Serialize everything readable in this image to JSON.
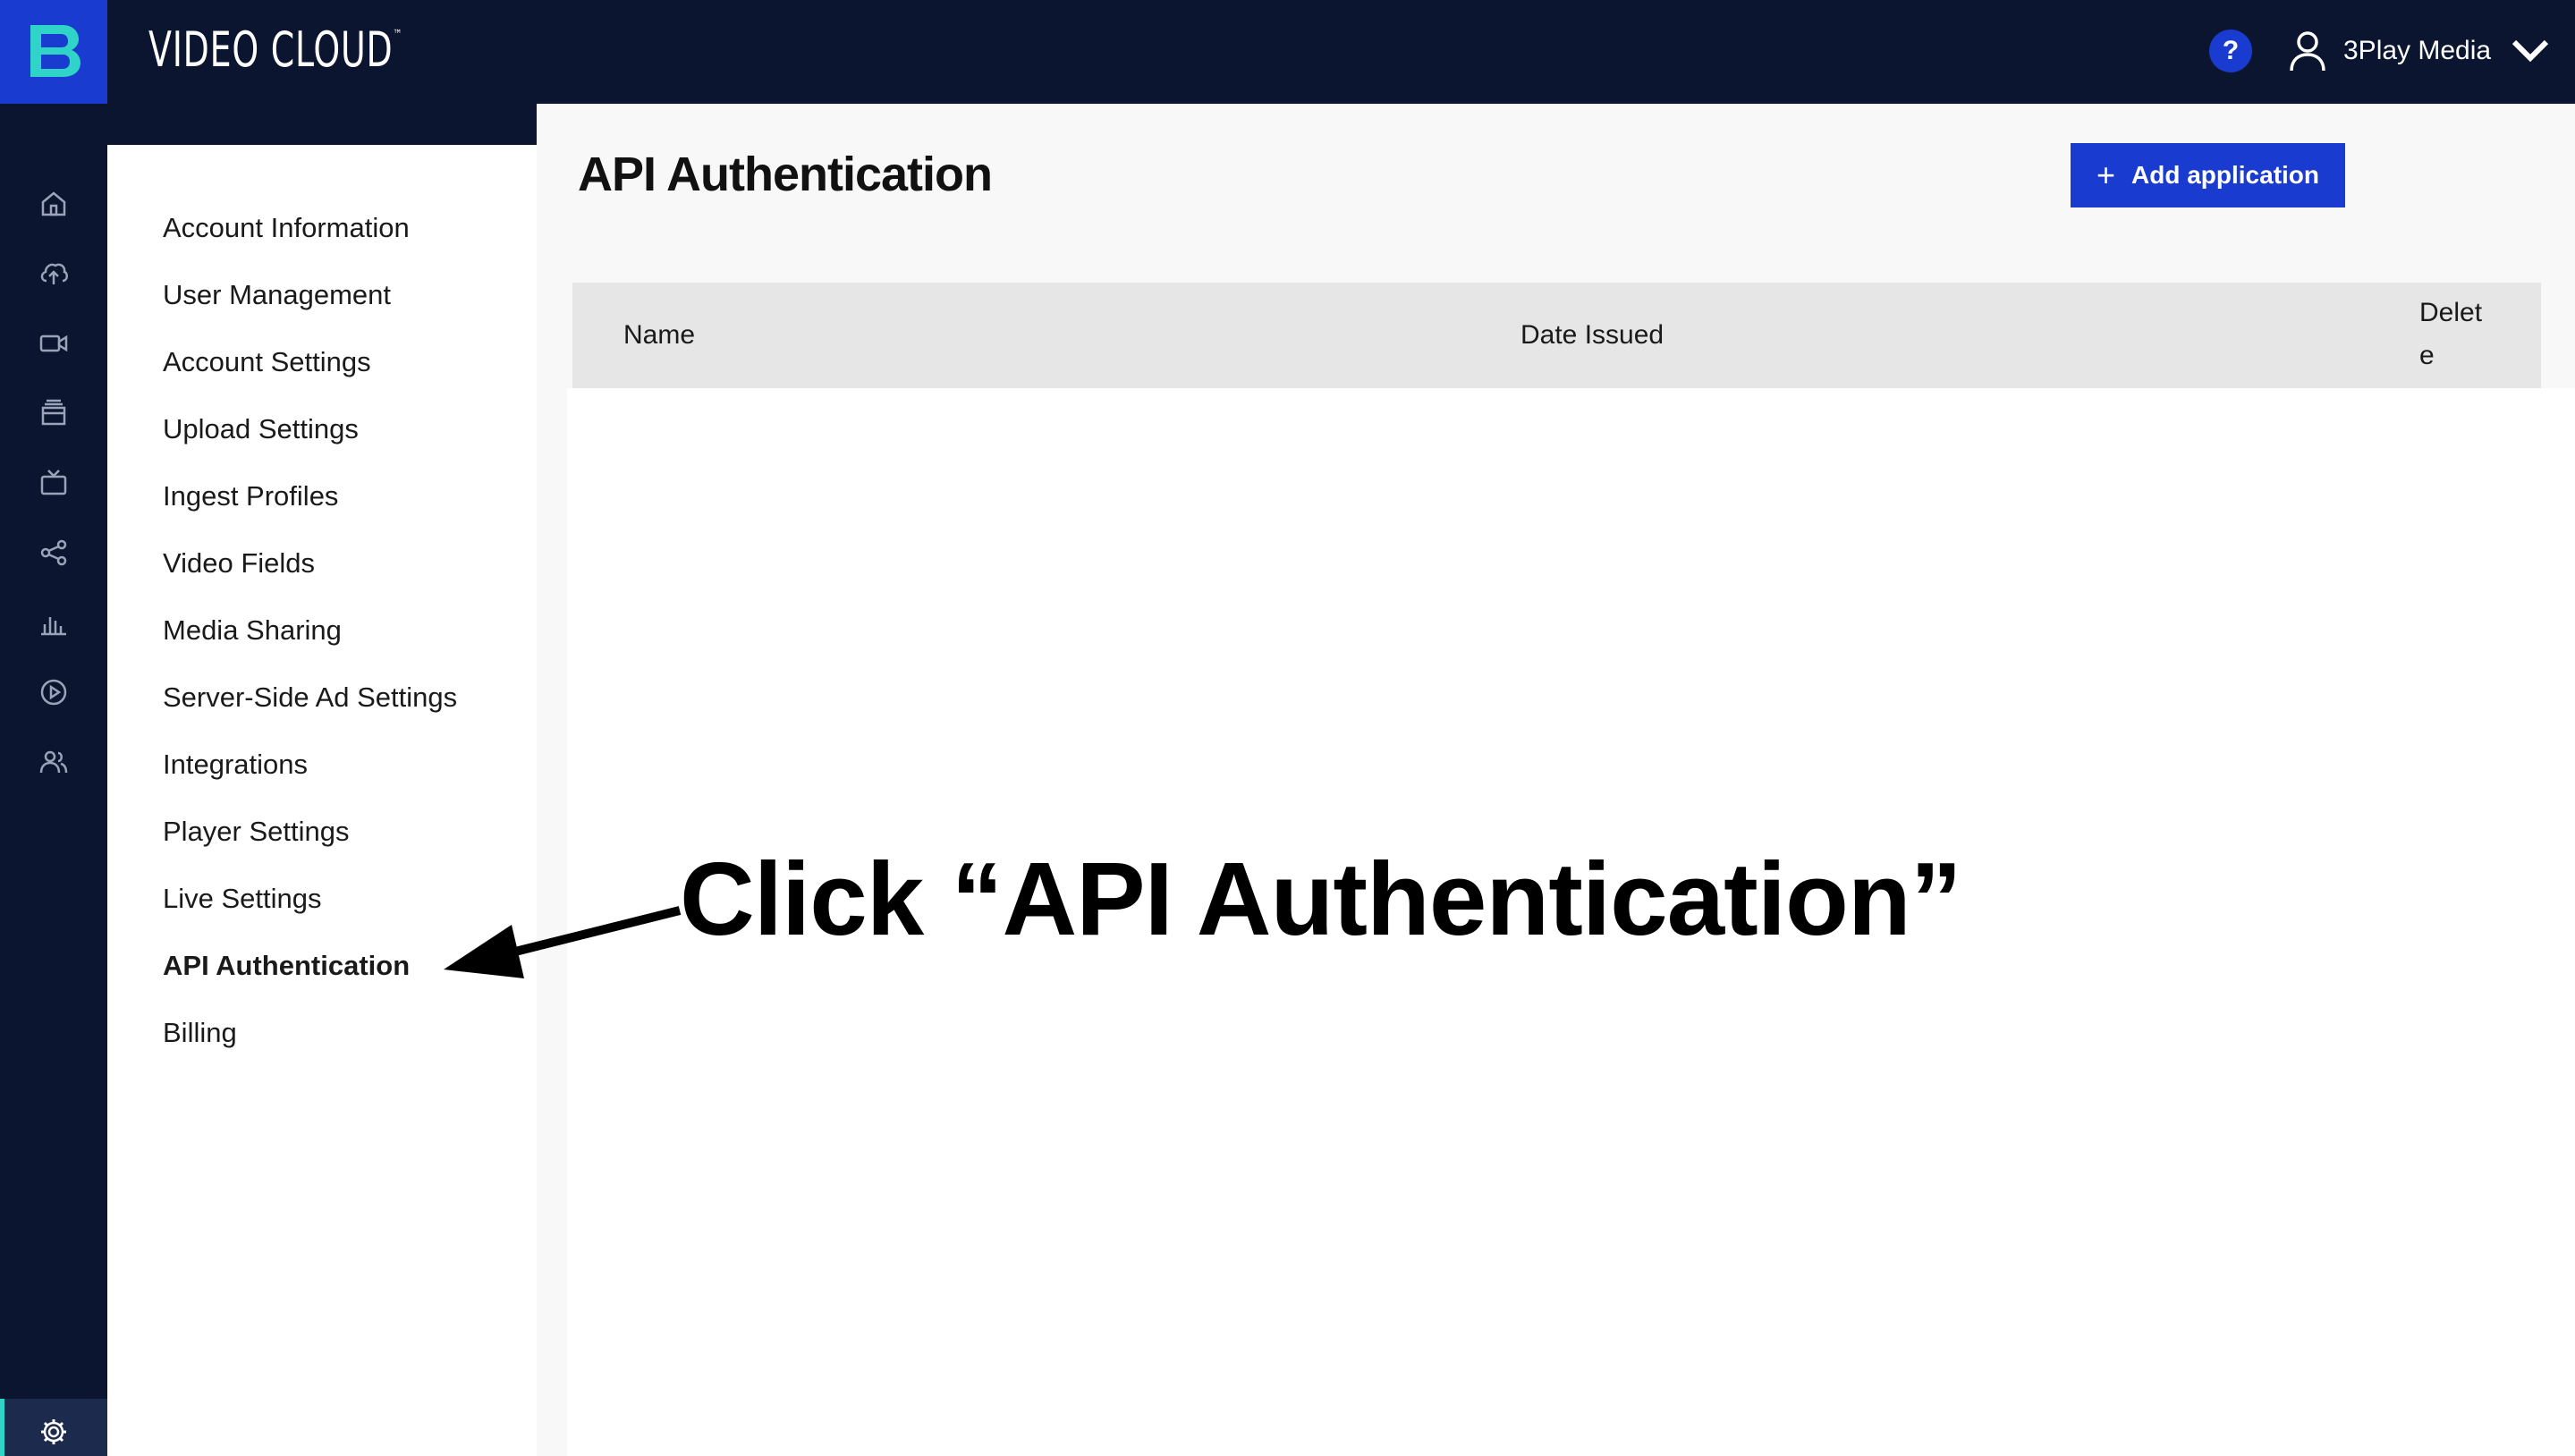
{
  "header": {
    "app_title": "VIDEO CLOUD",
    "trademark": "™",
    "help_label": "?",
    "user_name": "3Play Media"
  },
  "rail": {
    "items": [
      {
        "icon": "home-icon"
      },
      {
        "icon": "upload-icon"
      },
      {
        "icon": "video-camera-icon"
      },
      {
        "icon": "media-library-icon"
      },
      {
        "icon": "live-tv-icon"
      },
      {
        "icon": "social-share-icon"
      },
      {
        "icon": "analytics-icon"
      },
      {
        "icon": "players-icon"
      },
      {
        "icon": "audience-icon"
      },
      {
        "icon": "gear-icon",
        "active": true
      },
      {
        "icon": "cart-icon"
      }
    ]
  },
  "settings_nav": {
    "items": [
      {
        "label": "Account Information"
      },
      {
        "label": "User Management"
      },
      {
        "label": "Account Settings"
      },
      {
        "label": "Upload Settings"
      },
      {
        "label": "Ingest Profiles"
      },
      {
        "label": "Video Fields"
      },
      {
        "label": "Media Sharing"
      },
      {
        "label": "Server-Side Ad Settings"
      },
      {
        "label": "Integrations"
      },
      {
        "label": "Player Settings"
      },
      {
        "label": "Live Settings"
      },
      {
        "label": "API Authentication",
        "active": true
      },
      {
        "label": "Billing"
      }
    ]
  },
  "main": {
    "title": "API Authentication",
    "add_button": {
      "icon": "plus",
      "label": "Add application"
    },
    "table": {
      "columns": [
        "Name",
        "Date Issued",
        "Delete"
      ],
      "rows": []
    }
  },
  "annotation": {
    "text": "Click “API Authentication”"
  },
  "colors": {
    "topbar": "#0b1530",
    "brand_blue": "#1a3bd0",
    "active_accent": "#2fd3c7",
    "table_header": "#e5e6e5"
  }
}
